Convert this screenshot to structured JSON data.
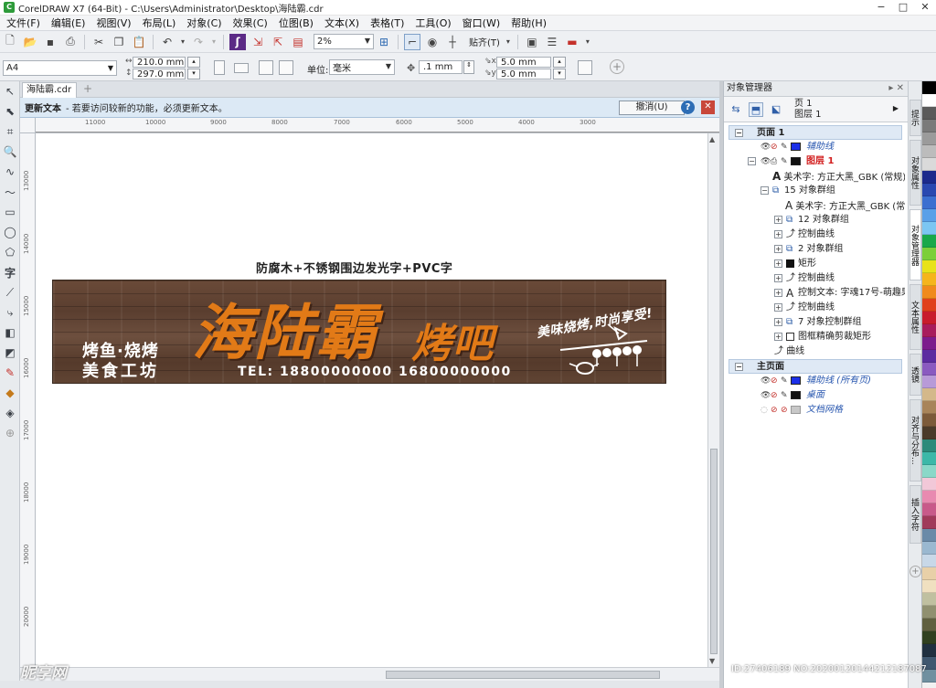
{
  "window": {
    "title": "CorelDRAW X7 (64-Bit) - C:\\Users\\Administrator\\Desktop\\海陆霸.cdr",
    "minimize": "−",
    "maximize": "□",
    "close": "✕"
  },
  "menu": [
    "文件(F)",
    "编辑(E)",
    "视图(V)",
    "布局(L)",
    "对象(C)",
    "效果(C)",
    "位图(B)",
    "文本(X)",
    "表格(T)",
    "工具(O)",
    "窗口(W)",
    "帮助(H)"
  ],
  "toolbar": {
    "zoom_value": "2%",
    "snap_label": "贴齐(T)"
  },
  "property_bar": {
    "page_size": "A4",
    "width": "210.0 mm",
    "height": "297.0 mm",
    "units_label": "单位:",
    "units_value": "毫米",
    "nudge": ".1 mm",
    "dup_x": "5.0 mm",
    "dup_y": "5.0 mm"
  },
  "document": {
    "tab_name": "海陆霸.cdr",
    "tab_add": "+"
  },
  "notification": {
    "title": "更新文本",
    "message": "- 若要访问较新的功能，必须更新文本。",
    "button": "撤消(U)",
    "help": "?",
    "close": "✕"
  },
  "ruler": {
    "top_labels": [
      "11000",
      "10000",
      "9000",
      "8000",
      "7000",
      "6000",
      "5000",
      "4000",
      "3000"
    ],
    "left_labels": [
      "13000",
      "14000",
      "15000",
      "16000",
      "17000",
      "18000",
      "19000",
      "20000"
    ]
  },
  "artwork": {
    "caption": "防腐木+不锈钢围边发光字+PVC字",
    "brand_main": "海陆霸",
    "brand_sub": "烤吧",
    "left_line1": "烤鱼·烧烤",
    "left_line2": "美食工坊",
    "tel": "TEL: 18800000000  16800000000",
    "slogan": "美味烧烤,时尚享受!"
  },
  "object_manager": {
    "title": "对象管理器",
    "page_line1": "页 1",
    "page_line2": "图层 1",
    "rows": [
      {
        "label": "页面 1"
      },
      {
        "label": "辅助线"
      },
      {
        "label": "图层 1"
      },
      {
        "label": "美术字: 方正大黑_GBK (常规) ("
      },
      {
        "label": "15 对象群组"
      },
      {
        "label": "美术字: 方正大黑_GBK (常规"
      },
      {
        "label": "12 对象群组"
      },
      {
        "label": "控制曲线"
      },
      {
        "label": "2 对象群组"
      },
      {
        "label": "矩形"
      },
      {
        "label": "控制曲线"
      },
      {
        "label": "控制文本: 字魂17号-萌趣果"
      },
      {
        "label": "控制曲线"
      },
      {
        "label": "7 对象控制群组"
      },
      {
        "label": "图框精确剪裁矩形"
      },
      {
        "label": "曲线"
      },
      {
        "label": "主页面"
      },
      {
        "label": "辅助线 (所有页)"
      },
      {
        "label": "桌面"
      },
      {
        "label": "文档网格"
      }
    ]
  },
  "dockers": [
    "提示",
    "对象属性",
    "对象管理器",
    "文本属性",
    "透镜",
    "对齐与分布...",
    "插入字符"
  ],
  "palette": [
    "#000000",
    "#ffffff",
    "#5a5a5a",
    "#7a7a7a",
    "#9b9b9b",
    "#bcbcbc",
    "#dadada",
    "#1c2a8c",
    "#2a48b0",
    "#3c6fd0",
    "#5aa0e8",
    "#7cc6f2",
    "#19a84a",
    "#7ccf3a",
    "#e8e21a",
    "#f5b51c",
    "#f08a1c",
    "#e0401c",
    "#c81c2c",
    "#a81c5c",
    "#7c1c8c",
    "#5c2ca0",
    "#8a5ac0",
    "#b89ad8",
    "#d4b88a",
    "#a8845a",
    "#7c5a3a",
    "#4a3a2a",
    "#2c8a7a",
    "#3cb8a8",
    "#8ad8c8",
    "#f2c8d8",
    "#e88ab0",
    "#c85a8a",
    "#a03a5a",
    "#6a8aa8",
    "#9ab8d0",
    "#c8d8e8",
    "#e8d0a8",
    "#f0e0c0",
    "#c0c0a0",
    "#909070",
    "#606040",
    "#304020",
    "#203040",
    "#405870",
    "#7090a0"
  ],
  "watermark": {
    "left": "昵享网",
    "right": "ID:27406189 NO:20200120144212187087"
  }
}
